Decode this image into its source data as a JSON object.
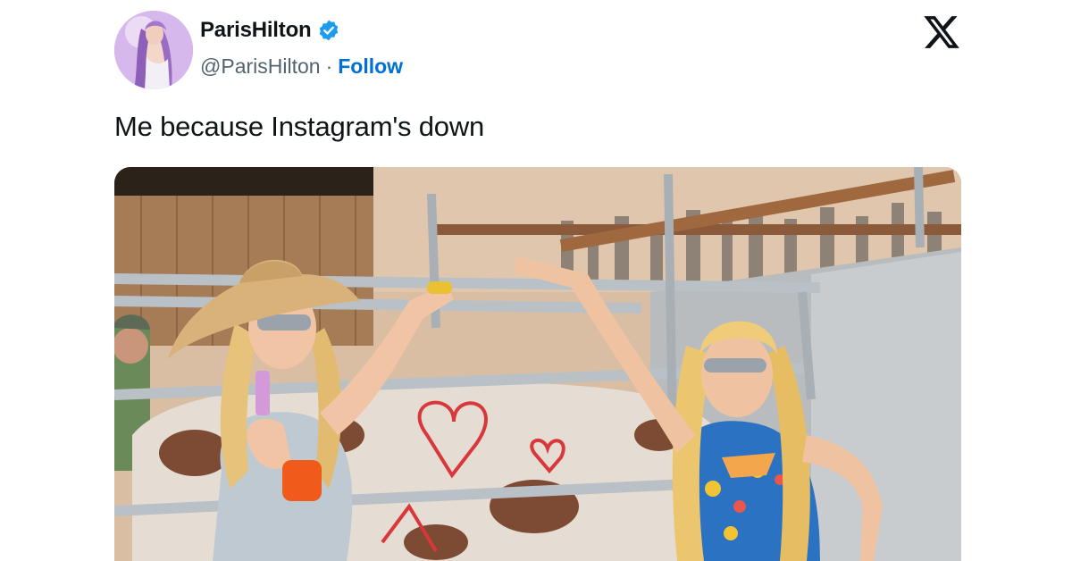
{
  "author": {
    "display_name": "ParisHilton",
    "handle": "@ParisHilton",
    "separator": "·",
    "follow_label": "Follow",
    "verified": true,
    "verified_color": "#1d9bf0"
  },
  "platform": {
    "logo_icon": "x-logo-icon",
    "logo_color": "#0f1419"
  },
  "tweet": {
    "text": "Me because Instagram's down"
  },
  "media": {
    "type": "photo",
    "icons": [
      "avatar",
      "verified-badge-icon",
      "x-logo-icon"
    ]
  },
  "colors": {
    "text_primary": "#0f1419",
    "text_secondary": "#536471",
    "link": "#006fd6"
  }
}
